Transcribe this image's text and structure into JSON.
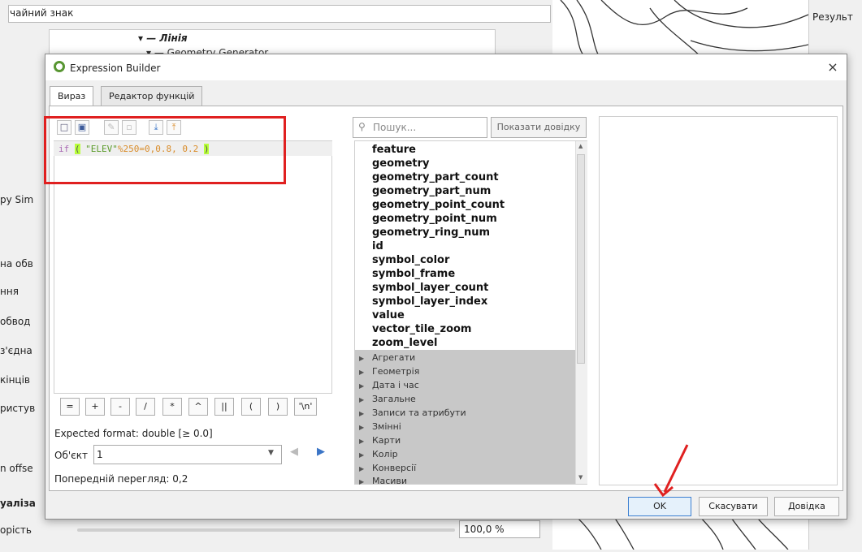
{
  "background": {
    "combo_text": "чайний знак",
    "tree_line": "Лінія",
    "tree_generator": "Geometry Generator",
    "side_labels": [
      "py Sim",
      "на обв",
      "ння",
      "обвод",
      "з'єдна",
      "кінців",
      "ристув",
      "n offse",
      "уаліза",
      "орість"
    ],
    "right_title": "Результ",
    "opacity_value": "100,0 %"
  },
  "dialog": {
    "title": "Expression Builder",
    "close": "×",
    "tabs": [
      "Вираз",
      "Редактор функцій"
    ],
    "toolbar_icons": [
      "new-file-icon",
      "save-icon",
      "edit-icon",
      "delete-icon",
      "import-icon",
      "export-icon"
    ],
    "expression": {
      "kw": "if",
      "open": "(",
      "field": "\"ELEV\"",
      "rest": "%250=0,0.8, 0.2",
      "close": ")"
    },
    "operators": [
      "=",
      "+",
      "-",
      "/",
      "*",
      "^",
      "||",
      "(",
      ")",
      "'\\n'"
    ],
    "expected_format": "Expected format: double [≥ 0.0]",
    "feature_label": "Об'єкт",
    "feature_value": "1",
    "preview": "Попередній перегляд: 0,2",
    "search_placeholder": "Пошук...",
    "show_help": "Показати довідку",
    "functions": [
      "feature",
      "geometry",
      "geometry_part_count",
      "geometry_part_num",
      "geometry_point_count",
      "geometry_point_num",
      "geometry_ring_num",
      "id",
      "symbol_color",
      "symbol_frame",
      "symbol_layer_count",
      "symbol_layer_index",
      "value",
      "vector_tile_zoom",
      "zoom_level"
    ],
    "groups": [
      "Агрегати",
      "Геометрія",
      "Дата і час",
      "Загальне",
      "Записи та атрибути",
      "Змінні",
      "Карти",
      "Колір",
      "Конверсії",
      "Масиви"
    ],
    "buttons": {
      "ok": "OK",
      "cancel": "Скасувати",
      "help": "Довідка"
    }
  },
  "colors": {
    "highlight": "#e02020",
    "accent": "#3c7fd1",
    "qgis": "#589632"
  }
}
